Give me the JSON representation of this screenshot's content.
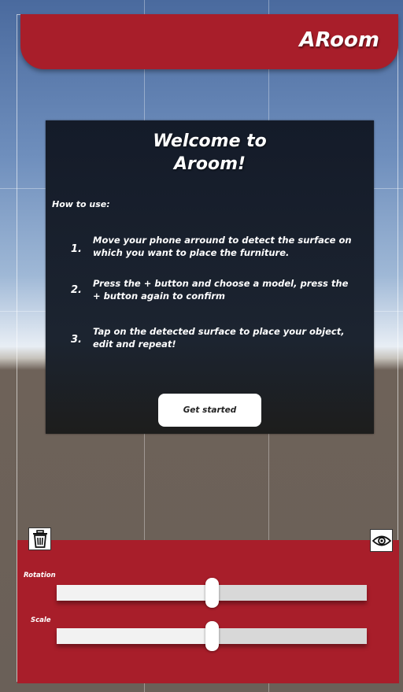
{
  "header": {
    "title": "ARoom"
  },
  "welcome_panel": {
    "title": "Welcome to\nAroom!",
    "how_to_label": "How to use:",
    "steps": [
      {
        "number": "1.",
        "text": "Move your phone arround to detect the surface on which you want to place the furniture."
      },
      {
        "number": "2.",
        "text": "Press the + button and choose a model, press the + button again to confirm"
      },
      {
        "number": "3.",
        "text": "Tap on the detected surface to place your object, edit and repeat!"
      }
    ],
    "button_label": "Get started"
  },
  "controls": {
    "rotation_label": "Rotation",
    "rotation_value": 0.5,
    "scale_label": "Scale",
    "scale_value": 0.5,
    "icons": {
      "delete": "trash-icon",
      "visibility": "eye-icon"
    }
  },
  "colors": {
    "accent": "#a81e2a",
    "panel": "#1a2230"
  }
}
